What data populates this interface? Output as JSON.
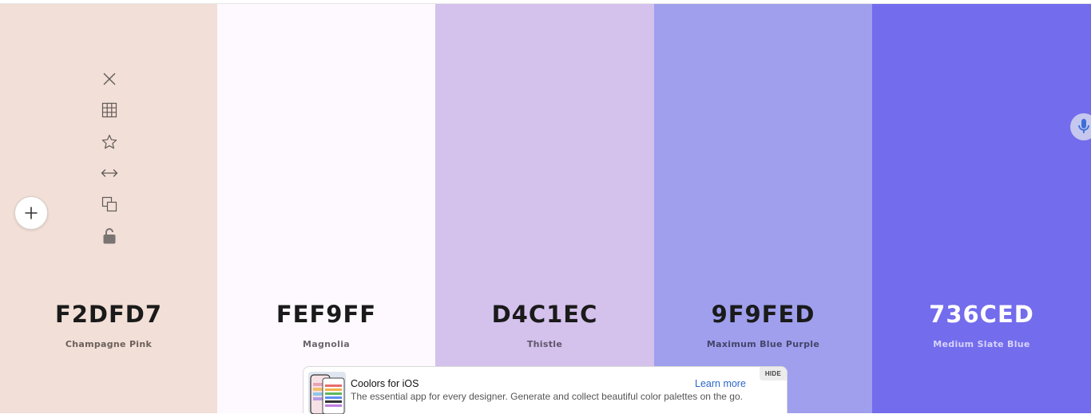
{
  "palette": {
    "colors": [
      {
        "hex": "F2DFD7",
        "name": "Champagne Pink",
        "bg": "#F2DFD7",
        "text_color": "#1a1a1a",
        "sub_color": "#6b5f5a"
      },
      {
        "hex": "FEF9FF",
        "name": "Magnolia",
        "bg": "#FEF9FF",
        "text_color": "#1a1a1a",
        "sub_color": "#6b676d"
      },
      {
        "hex": "D4C1EC",
        "name": "Thistle",
        "bg": "#D4C1EC",
        "text_color": "#1a1a1a",
        "sub_color": "#5e5668"
      },
      {
        "hex": "9F9FED",
        "name": "Maximum Blue Purple",
        "bg": "#9F9FED",
        "text_color": "#1a1a1a",
        "sub_color": "#44446a"
      },
      {
        "hex": "736CED",
        "name": "Medium Slate Blue",
        "bg": "#736CED",
        "text_color": "#ffffff",
        "sub_color": "#d6d3fa"
      }
    ],
    "swatch_tools": [
      {
        "icon": "close-icon"
      },
      {
        "icon": "shades-grid-icon"
      },
      {
        "icon": "star-icon"
      },
      {
        "icon": "drag-arrows-icon"
      },
      {
        "icon": "copy-icon"
      },
      {
        "icon": "lock-open-icon"
      }
    ],
    "add_button_icon": "plus-icon",
    "mic_icon": "microphone-icon"
  },
  "ad": {
    "title": "Coolors for iOS",
    "description": "The essential app for every designer. Generate and collect beautiful color palettes on the go.",
    "link_label": "Learn more",
    "hide_label": "HIDE"
  }
}
